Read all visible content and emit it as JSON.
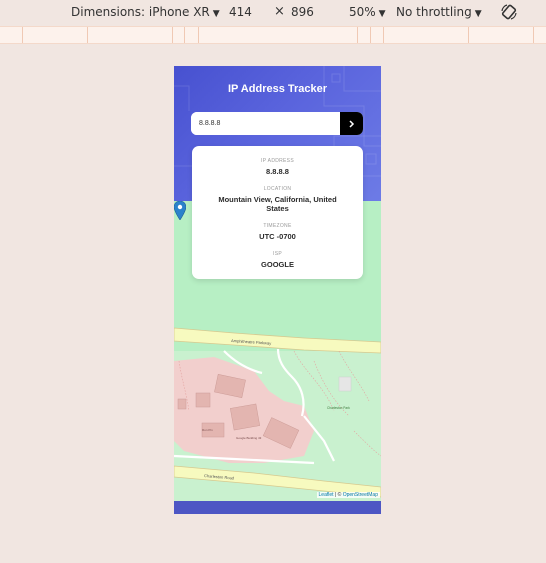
{
  "devtools": {
    "dimensions_label": "Dimensions: iPhone XR",
    "width": "414",
    "times": "×",
    "height": "896",
    "zoom": "50%",
    "throttling": "No throttling",
    "icons": [
      "chevron-down-icon",
      "rotate-icon"
    ]
  },
  "app": {
    "title": "IP Address Tracker",
    "search_value": "8.8.8.8",
    "submit_icon": "chevron-right-icon",
    "accent_color": "#4d56c4"
  },
  "info": {
    "ip_label": "IP ADDRESS",
    "ip_value": "8.8.8.8",
    "location_label": "LOCATION",
    "location_line1": "Mountain View, California, United",
    "location_line2": "States",
    "timezone_label": "TIMEZONE",
    "timezone_value": "UTC -0700",
    "isp_label": "ISP",
    "isp_value": "GOOGLE"
  },
  "map": {
    "road1": "Amphitheatre Parkway",
    "road2": "Charleston Road",
    "labels": [
      "Charleston Park",
      "Google Building 43",
      "Run Pin"
    ],
    "attribution_leaflet": "Leaflet",
    "attribution_sep": " | © ",
    "attribution_osm": "OpenStreetMap",
    "marker_icon": "map-pin-icon"
  }
}
